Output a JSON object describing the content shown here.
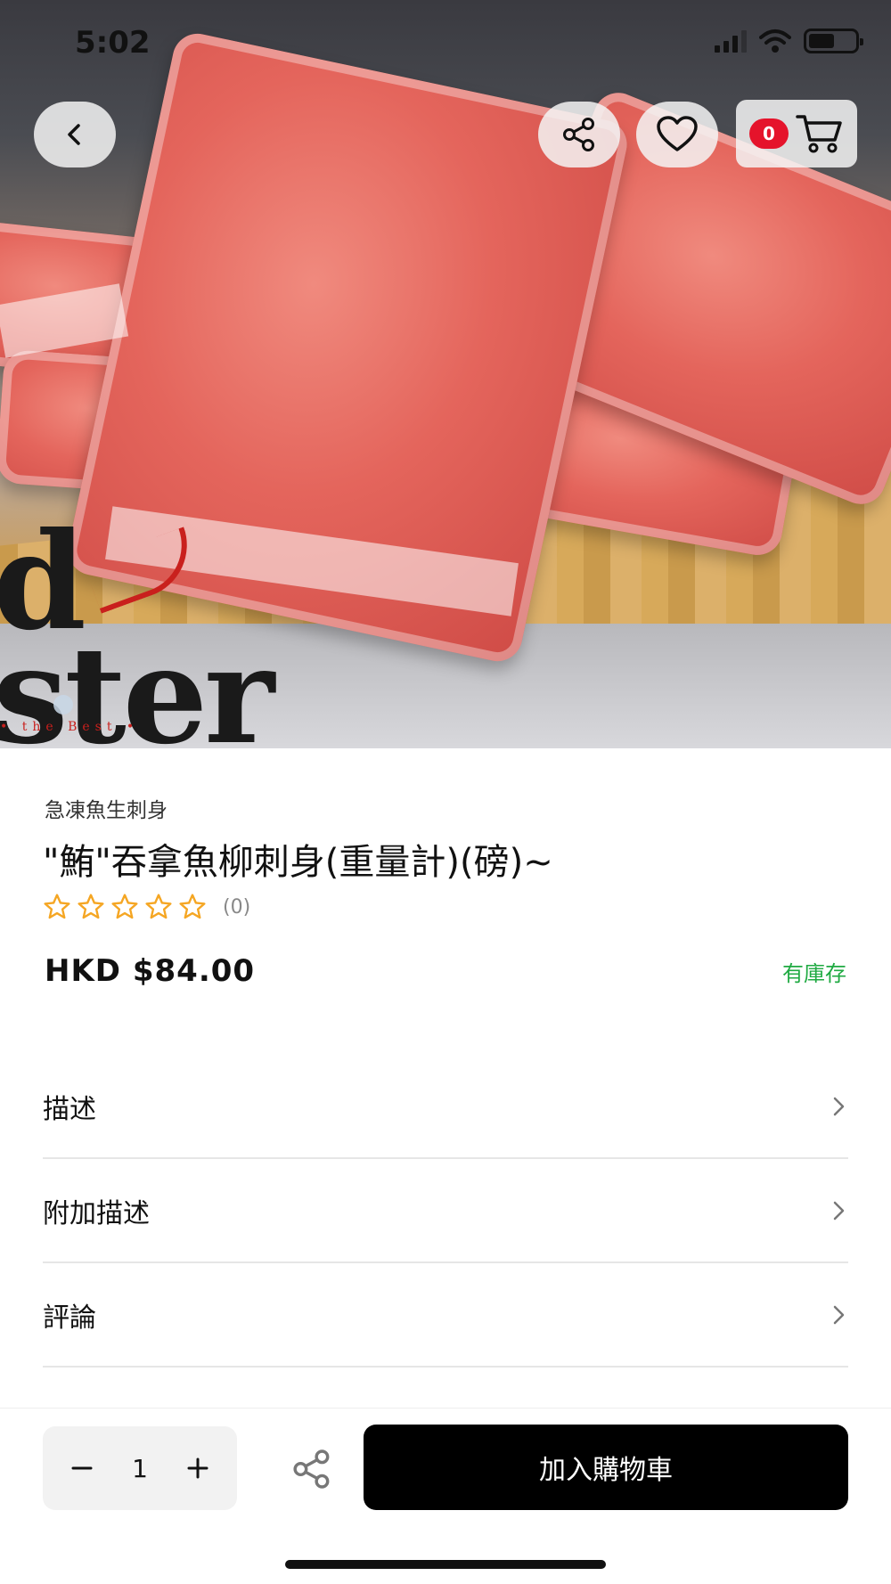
{
  "status_bar": {
    "time": "5:02"
  },
  "hero": {
    "logo_line_1": "d",
    "logo_line_2": "ster",
    "logo_small": "• the Best •",
    "carousel_active_index": 1
  },
  "top_actions": {
    "cart_count": "0"
  },
  "product": {
    "category": "急凍魚生刺身",
    "title": "\"鮪\"吞拿魚柳刺身(重量計)(磅)~",
    "rating_stars": 0,
    "rating_count": "(0)",
    "price": "HKD $84.00",
    "stock": "有庫存"
  },
  "sections": [
    {
      "label": "描述"
    },
    {
      "label": "附加描述"
    },
    {
      "label": "評論"
    }
  ],
  "bottom_bar": {
    "quantity": "1",
    "add_to_cart_label": "加入購物車"
  },
  "colors": {
    "accent_black": "#000000",
    "stock_green": "#1faa42",
    "star_orange": "#f5a623",
    "badge_red": "#e5132b"
  }
}
